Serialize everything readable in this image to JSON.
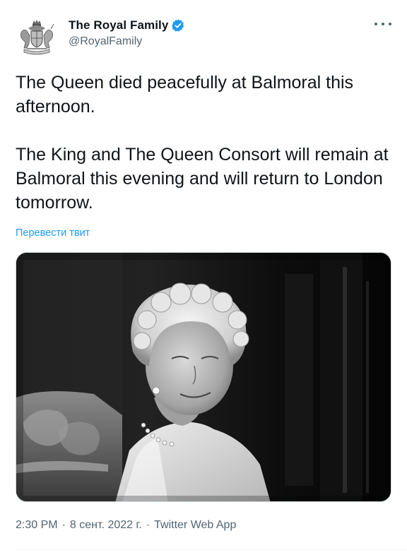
{
  "author": {
    "display_name": "The Royal Family",
    "handle": "@RoyalFamily",
    "verified": true,
    "verified_color": "#1d9bf0",
    "avatar_icon": "royal-coat-of-arms-icon"
  },
  "tweet": {
    "paragraph_1": "The Queen died peacefully at Balmoral this afternoon.",
    "paragraph_2": "The King and The Queen Consort will remain at Balmoral this evening and will return to London tomorrow.",
    "translate_link": "Перевести твит",
    "media_alt": "Black and white portrait photograph"
  },
  "meta": {
    "time": "2:30 PM",
    "separator": "·",
    "date": "8 сент. 2022 г.",
    "source": "Twitter Web App"
  },
  "colors": {
    "accent": "#1d9bf0",
    "text_primary": "#0f1419",
    "text_secondary": "#536471"
  }
}
